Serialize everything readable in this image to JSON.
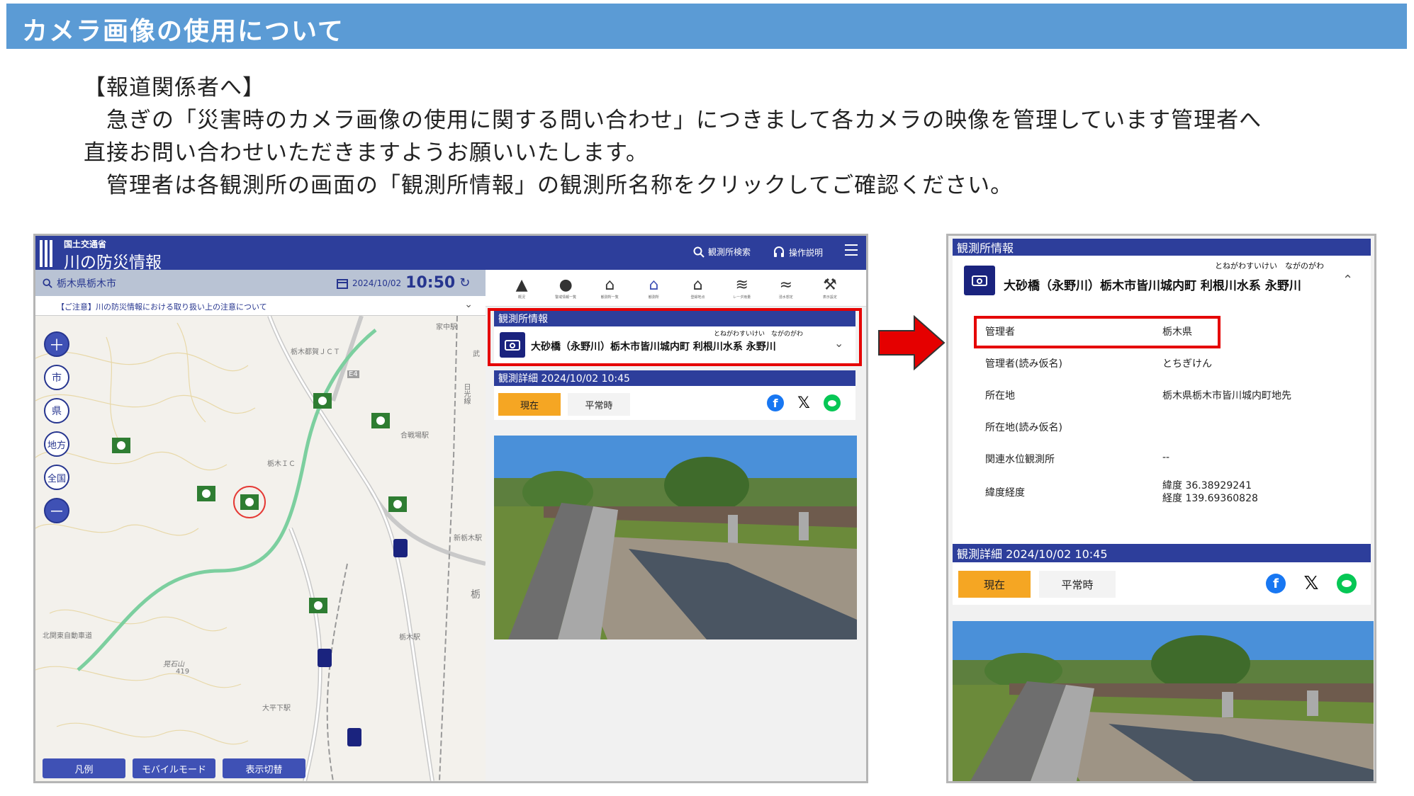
{
  "banner": {
    "title": "カメラ画像の使用について"
  },
  "intro": {
    "heading": "【報道関係者へ】",
    "line1": "　急ぎの「災害時のカメラ画像の使用に関する問い合わせ」につきまして各カメラの映像を管理しています管理者へ",
    "line2": "直接お問い合わせいただきますようお願いいたします。",
    "line3": "　管理者は各観測所の画面の「観測所情報」の観測所名称をクリックしてご確認ください。"
  },
  "left_app": {
    "ministry": "国土交通省",
    "title": "川の防災情報",
    "search_label": "観測所検索",
    "help_label": "操作説明",
    "location": "栃木県栃木市",
    "date": "2024/10/02",
    "time": "10:50",
    "notice": "【ご注意】川の防災情報における取り扱い上の注意について",
    "zoom_in": "＋",
    "zoom_out": "－",
    "scale_city": "市",
    "scale_pref": "県",
    "scale_region": "地方",
    "scale_nation": "全国",
    "btn_legend": "凡例",
    "btn_mobile": "モバイルモード",
    "btn_display": "表示切替",
    "map_labels": {
      "l1": "栃木都賀ＪＣＴ",
      "l2": "栃木ＩＣ",
      "l3": "合戦場駅",
      "l4": "新栃木駅",
      "l5": "栃木駅",
      "l6": "晃石山",
      "l7": "北関東自動車道",
      "l8": "大平下駅",
      "l9": "家中駅",
      "l10": "E4",
      "l11": "419",
      "l12": "栃",
      "l13": "武",
      "l14": "日光線"
    },
    "nav": [
      {
        "label": "概況",
        "icon": "warning-icon"
      },
      {
        "label": "警戒情報一覧",
        "icon": "alert-icon"
      },
      {
        "label": "観測所一覧",
        "icon": "list-house-icon"
      },
      {
        "label": "観測所",
        "icon": "home-icon"
      },
      {
        "label": "登録地点",
        "icon": "house-icon"
      },
      {
        "label": "レーダ雨量",
        "icon": "rss-icon"
      },
      {
        "label": "浸水想定",
        "icon": "waves-icon"
      },
      {
        "label": "表示設定",
        "icon": "wrench-icon"
      }
    ],
    "station_info_title": "観測所情報",
    "station_furigana": "とねがわすいけい　ながのがわ",
    "station_name": "大砂橋（永野川）栃木市皆川城内町 利根川水系 永野川",
    "detail_title": "観測詳細  2024/10/02 10:45",
    "tab_now": "現在",
    "tab_normal": "平常時"
  },
  "right_app": {
    "station_info_title": "観測所情報",
    "station_furigana": "とねがわすいけい　ながのがわ",
    "station_name": "大砂橋（永野川）栃木市皆川城内町 利根川水系 永野川",
    "rows": [
      {
        "label": "管理者",
        "value": "栃木県"
      },
      {
        "label": "管理者(読み仮名)",
        "value": "とちぎけん"
      },
      {
        "label": "所在地",
        "value": "栃木県栃木市皆川城内町地先"
      },
      {
        "label": "所在地(読み仮名)",
        "value": ""
      },
      {
        "label": "関連水位観測所",
        "value": "--"
      }
    ],
    "coord_label": "緯度経度",
    "lat": "緯度 36.38929241",
    "lon": "経度 139.69360828",
    "detail_title": "観測詳細  2024/10/02 10:45",
    "tab_now": "現在",
    "tab_normal": "平常時"
  },
  "colors": {
    "banner": "#5b9bd5",
    "app_header": "#2d3e9b",
    "highlight": "#e50000",
    "tab_now": "#f5a623"
  }
}
